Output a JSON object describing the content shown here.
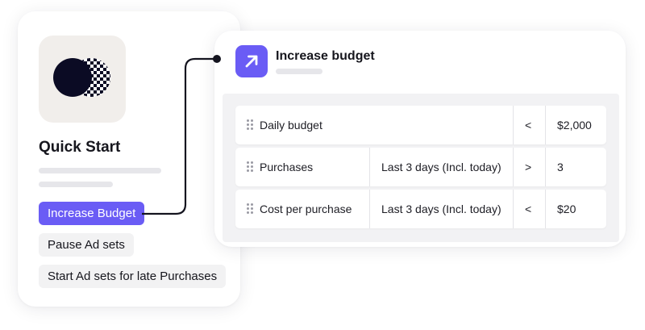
{
  "left_card": {
    "title": "Quick Start",
    "logo_icon": "half-moon-checker-logo",
    "buttons": [
      {
        "label": "Increase Budget",
        "active": true
      },
      {
        "label": "Pause Ad sets",
        "active": false
      },
      {
        "label": "Start Ad sets for late Purchases",
        "active": false
      }
    ]
  },
  "right_card": {
    "title": "Increase budget",
    "icon": "arrow-up-right-icon",
    "rules": [
      {
        "metric": "Daily budget",
        "window": "",
        "operator": "<",
        "value": "$2,000"
      },
      {
        "metric": "Purchases",
        "window": "Last 3 days (Incl. today)",
        "operator": ">",
        "value": "3"
      },
      {
        "metric": "Cost per purchase",
        "window": "Last 3 days (Incl. today)",
        "operator": "<",
        "value": "$20"
      }
    ]
  },
  "colors": {
    "accent": "#6a5cf5",
    "logo_dark": "#0b0b24",
    "tile_bg": "#f1eeeb"
  }
}
